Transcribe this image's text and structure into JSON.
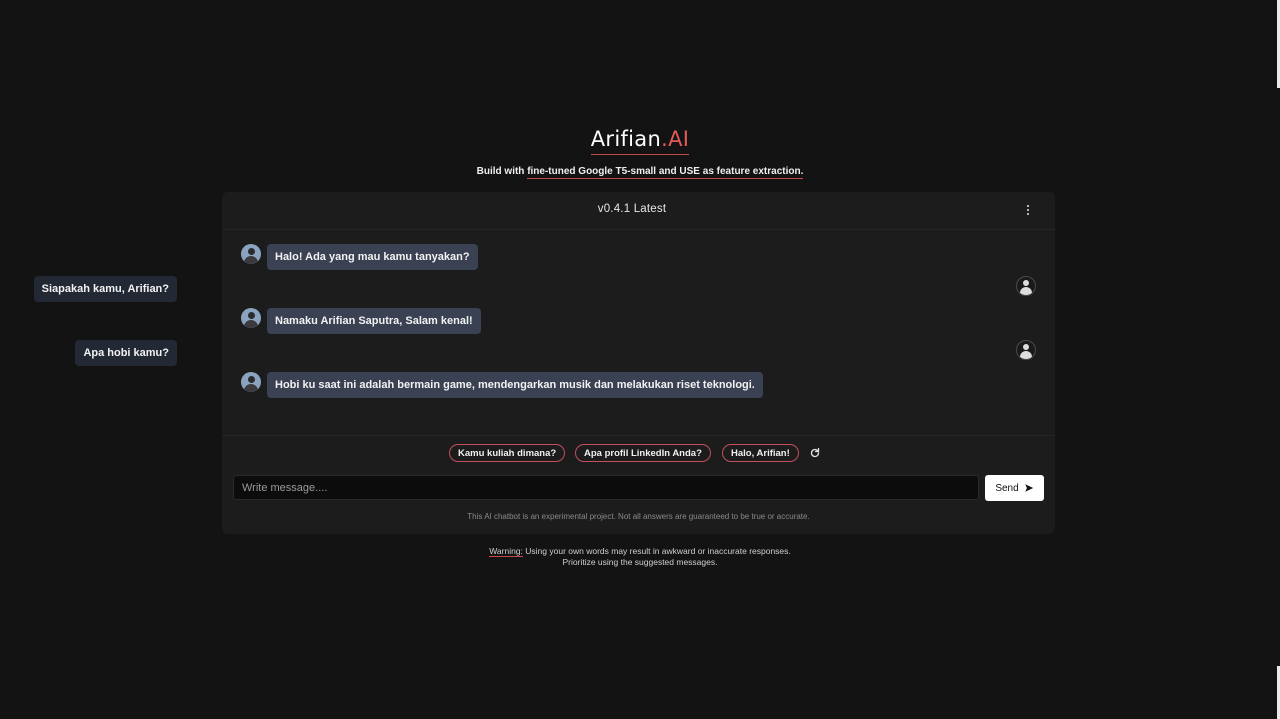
{
  "brand": {
    "name": "Arifian",
    "accent": ".AI",
    "accent_color": "#e05a5a"
  },
  "subtitle": {
    "prefix": "Build with ",
    "link": "fine-tuned Google T5-small and USE as feature extraction."
  },
  "chat": {
    "version": "v0.4.1 Latest",
    "menu_icon": "vertical-ellipsis-icon",
    "messages": [
      {
        "role": "bot",
        "text": "Halo! Ada yang mau kamu tanyakan?"
      },
      {
        "role": "user",
        "text": "Siapakah kamu, Arifian?"
      },
      {
        "role": "bot",
        "text": "Namaku Arifian Saputra, Salam kenal!"
      },
      {
        "role": "user",
        "text": "Apa hobi kamu?"
      },
      {
        "role": "bot",
        "text": "Hobi ku saat ini adalah bermain game, mendengarkan musik dan melakukan riset teknologi."
      }
    ],
    "suggestions": [
      "Kamu kuliah dimana?",
      "Apa profil LinkedIn Anda?",
      "Halo, Arifian!"
    ],
    "refresh_icon": "refresh-icon",
    "input": {
      "placeholder": "Write message....",
      "value": ""
    },
    "send_label": "Send",
    "send_icon": "send-arrow-icon",
    "disclaimer": "This AI chatbot is an experimental project. Not all answers are guaranteed to be true or accurate."
  },
  "warning": {
    "label": "Warning:",
    "line1": " Using your own words may result in awkward or inaccurate responses.",
    "line2": "Prioritize using the suggested messages."
  }
}
